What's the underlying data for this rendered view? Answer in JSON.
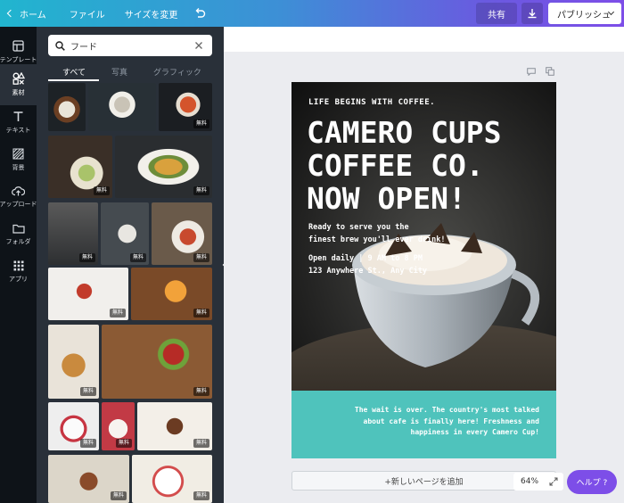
{
  "topbar": {
    "home": "ホーム",
    "file": "ファイル",
    "resize": "サイズを変更",
    "share": "共有",
    "publish": "パブリッシュ"
  },
  "rail": {
    "items": [
      {
        "label": "テンプレート",
        "icon": "template-icon"
      },
      {
        "label": "素材",
        "icon": "elements-icon"
      },
      {
        "label": "テキスト",
        "icon": "text-icon"
      },
      {
        "label": "背景",
        "icon": "background-icon"
      },
      {
        "label": "アップロード",
        "icon": "upload-icon"
      },
      {
        "label": "フォルダ",
        "icon": "folder-icon"
      },
      {
        "label": "アプリ",
        "icon": "apps-icon"
      }
    ]
  },
  "panel": {
    "search_value": "フード",
    "tabs": [
      "すべて",
      "写真",
      "グラフィック"
    ],
    "free_badge": "無料"
  },
  "design": {
    "tagline": "LIFE BEGINS WITH COFFEE.",
    "headline": [
      "CAMERO CUPS",
      "COFFEE CO.",
      "NOW OPEN!"
    ],
    "sub1": "Ready to serve you the",
    "sub2": "finest brew you'll ever drink!",
    "hours": "Open daily | 9 AM to 8 PM",
    "address": "123 Anywhere St., Any City",
    "footer": [
      "The wait is over. The country's most talked",
      "about cafe is finally here! Freshness and",
      "happiness in every Camero Cup!"
    ]
  },
  "canvas": {
    "add_page": "+新しいページを追加",
    "zoom": "64%",
    "help": "ヘルプ ?"
  },
  "colors": {
    "accent": "#7d4ee8",
    "teal": "#4fc3bc",
    "panel": "#293039",
    "rail": "#0e1318"
  }
}
